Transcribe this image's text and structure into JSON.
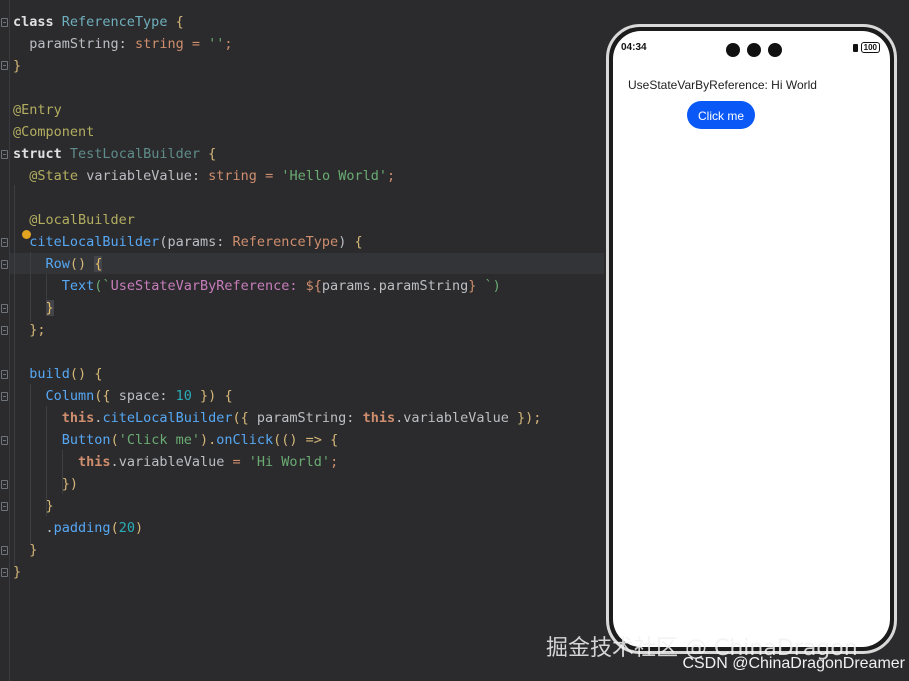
{
  "code": {
    "l1": {
      "k": "class",
      "name": "ReferenceType",
      "b": "{"
    },
    "l2": {
      "prop": "paramString",
      "colon": ":",
      "type": "string",
      "eq": "=",
      "val": "''",
      "semi": ";"
    },
    "l3": {
      "b": "}"
    },
    "l5": {
      "deco": "@Entry"
    },
    "l6": {
      "deco": "@Component"
    },
    "l7": {
      "k": "struct",
      "name": "TestLocalBuilder",
      "b": "{"
    },
    "l8": {
      "deco": "@State",
      "prop": "variableValue",
      "colon": ":",
      "type": "string",
      "eq": "=",
      "val": "'Hello World'",
      "semi": ";"
    },
    "l10": {
      "deco": "@LocalBuilder"
    },
    "l11": {
      "fn": "citeLocalBuilder",
      "open": "(",
      "param": "params",
      "colon": ":",
      "type": "ReferenceType",
      "close": ")",
      "b": "{"
    },
    "l12": {
      "fn": "Row",
      "paren": "()",
      "b": "{"
    },
    "l13": {
      "fn": "Text",
      "open": "(`",
      "tmpl": "UseStateVarByReference: ",
      "d": "${",
      "expr": "params.paramString",
      "e": "}",
      "tail": " `)"
    },
    "l14": {
      "b": "}"
    },
    "l15": {
      "b": "};"
    },
    "l17": {
      "fn": "build",
      "paren": "()",
      "b": "{"
    },
    "l18": {
      "fn": "Column",
      "open": "({",
      "key": "space",
      "colon": ":",
      "num": "10",
      "close": "})",
      "b": "{"
    },
    "l19": {
      "this": "this",
      "dot": ".",
      "fn": "citeLocalBuilder",
      "open": "({",
      "key": "paramString",
      "colon": ":",
      "this2": "this",
      "dot2": ".",
      "prop": "variableValue",
      "close": "});"
    },
    "l20": {
      "fn": "Button",
      "open": "(",
      "str": "'Click me'",
      "mid": ").",
      "fn2": "onClick",
      "open2": "(() =>",
      "b": "{"
    },
    "l21": {
      "this": "this",
      "dot": ".",
      "prop": "variableValue",
      "eq": "=",
      "str": "'Hi World'",
      "semi": ";"
    },
    "l22": {
      "b": "})"
    },
    "l23": {
      "b": "}"
    },
    "l24": {
      "dot": ".",
      "fn": "padding",
      "open": "(",
      "num": "20",
      "close": ")"
    },
    "l25": {
      "b": "}"
    },
    "l26": {
      "b": "}"
    }
  },
  "phone": {
    "time": "04:34",
    "battery": "100",
    "text": "UseStateVarByReference: Hi World",
    "button": "Click me"
  },
  "watermark": {
    "line1": "掘金技术社区 @ ChinaDragon",
    "line2": "CSDN @ChinaDragonDreamer"
  },
  "colors": {
    "editor_bg": "#2b2b2d",
    "keyword": "#cf8e6d",
    "string": "#6aab73",
    "decorator": "#b3ae60",
    "function": "#56a8f5",
    "property": "#c77dbb",
    "button": "#0a59f7"
  }
}
